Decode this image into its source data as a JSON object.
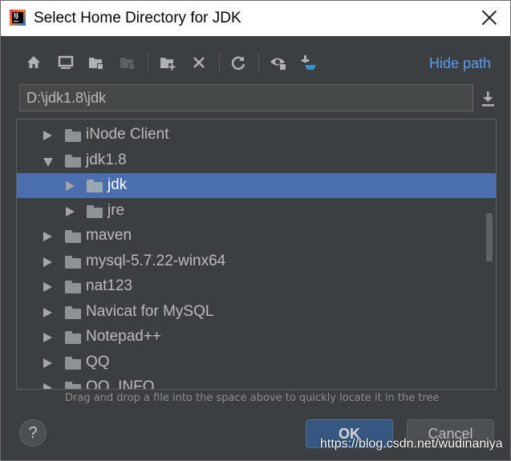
{
  "window": {
    "title": "Select Home Directory for JDK",
    "close_icon": "close-icon"
  },
  "toolbar": {
    "icons": [
      "home-icon",
      "desktop-icon",
      "project-folder-icon",
      "module-folder-icon",
      "new-folder-icon",
      "delete-icon",
      "refresh-icon",
      "show-hidden-icon",
      "jdk-icon"
    ],
    "hide_path_label": "Hide path"
  },
  "path_field": {
    "value": "D:\\jdk1.8\\jdk"
  },
  "tree": {
    "items": [
      {
        "label": "iNode Client",
        "level": 1,
        "expanded": false,
        "selected": false
      },
      {
        "label": "jdk1.8",
        "level": 1,
        "expanded": true,
        "selected": false
      },
      {
        "label": "jdk",
        "level": 2,
        "expanded": false,
        "selected": true
      },
      {
        "label": "jre",
        "level": 2,
        "expanded": false,
        "selected": false
      },
      {
        "label": "maven",
        "level": 1,
        "expanded": false,
        "selected": false
      },
      {
        "label": "mysql-5.7.22-winx64",
        "level": 1,
        "expanded": false,
        "selected": false
      },
      {
        "label": "nat123",
        "level": 1,
        "expanded": false,
        "selected": false
      },
      {
        "label": "Navicat for MySQL",
        "level": 1,
        "expanded": false,
        "selected": false
      },
      {
        "label": "Notepad++",
        "level": 1,
        "expanded": false,
        "selected": false
      },
      {
        "label": "QQ",
        "level": 1,
        "expanded": false,
        "selected": false
      },
      {
        "label": "QQ_INFO",
        "level": 1,
        "expanded": false,
        "selected": false
      }
    ]
  },
  "hint": "Drag and drop a file into the space above to quickly locate it in the tree",
  "buttons": {
    "help": "?",
    "ok": "OK",
    "cancel": "Cancel"
  },
  "watermark": "https://blog.csdn.net/wudinaniya",
  "colors": {
    "background": "#3c3f41",
    "selection": "#4b6eaf",
    "link": "#589df6",
    "ok_button": "#365880"
  }
}
